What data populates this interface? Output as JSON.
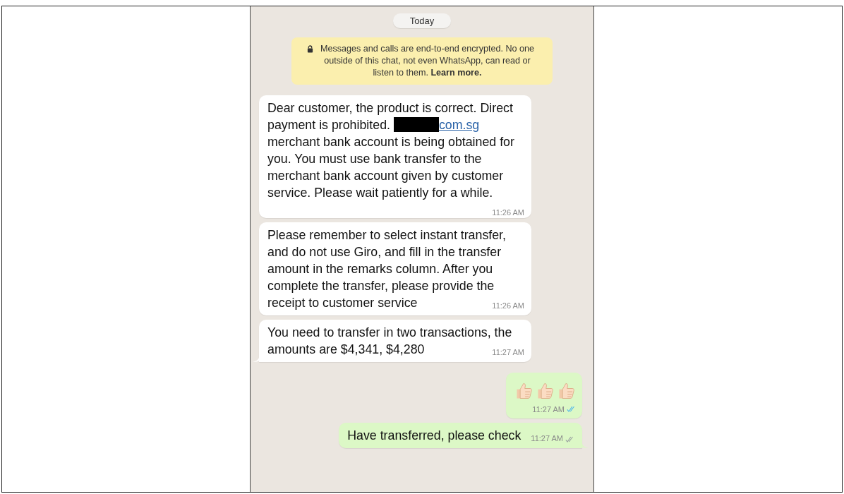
{
  "chat": {
    "date_chip": "Today",
    "notice": "Messages and calls are end-to-end encrypted. No one outside of this chat, not even WhatsApp, can read or listen to them. **Learn more.**",
    "messages": [
      {
        "kind": "incoming",
        "tail": false,
        "segments": [
          {
            "kind": "text",
            "text": "Dear customer, the product is correct. Direct payment is prohibited. "
          },
          {
            "kind": "redaction"
          },
          {
            "kind": "link",
            "text": "com.sg"
          },
          {
            "kind": "text",
            "text": " merchant bank account is being obtained for you. You must use bank transfer to the merchant bank account given by customer service. Please wait patiently for a while."
          }
        ],
        "time": "11:26 AM"
      },
      {
        "kind": "incoming",
        "tail": false,
        "segments": [
          {
            "kind": "text",
            "text": "Please remember to select instant transfer, and do not use Giro, and fill in the transfer amount in the remarks column. After you complete the transfer, please provide the receipt to customer service"
          }
        ],
        "time": "11:26 AM"
      },
      {
        "kind": "incoming",
        "tail": true,
        "segments": [
          {
            "kind": "text",
            "text": "You need to transfer in two transactions, the amounts are $4,341, $4,280"
          }
        ],
        "time": "11:27 AM"
      },
      {
        "kind": "outgoing",
        "tail": false,
        "segments": [
          {
            "kind": "thumbs_up"
          },
          {
            "kind": "thumbs_up"
          },
          {
            "kind": "thumbs_up"
          }
        ],
        "time": "11:27 AM",
        "read": true
      },
      {
        "kind": "outgoing",
        "tail": true,
        "segments": [
          {
            "kind": "text",
            "text": "Have transferred, please check"
          }
        ],
        "time": "11:27 AM",
        "read": false
      }
    ]
  }
}
